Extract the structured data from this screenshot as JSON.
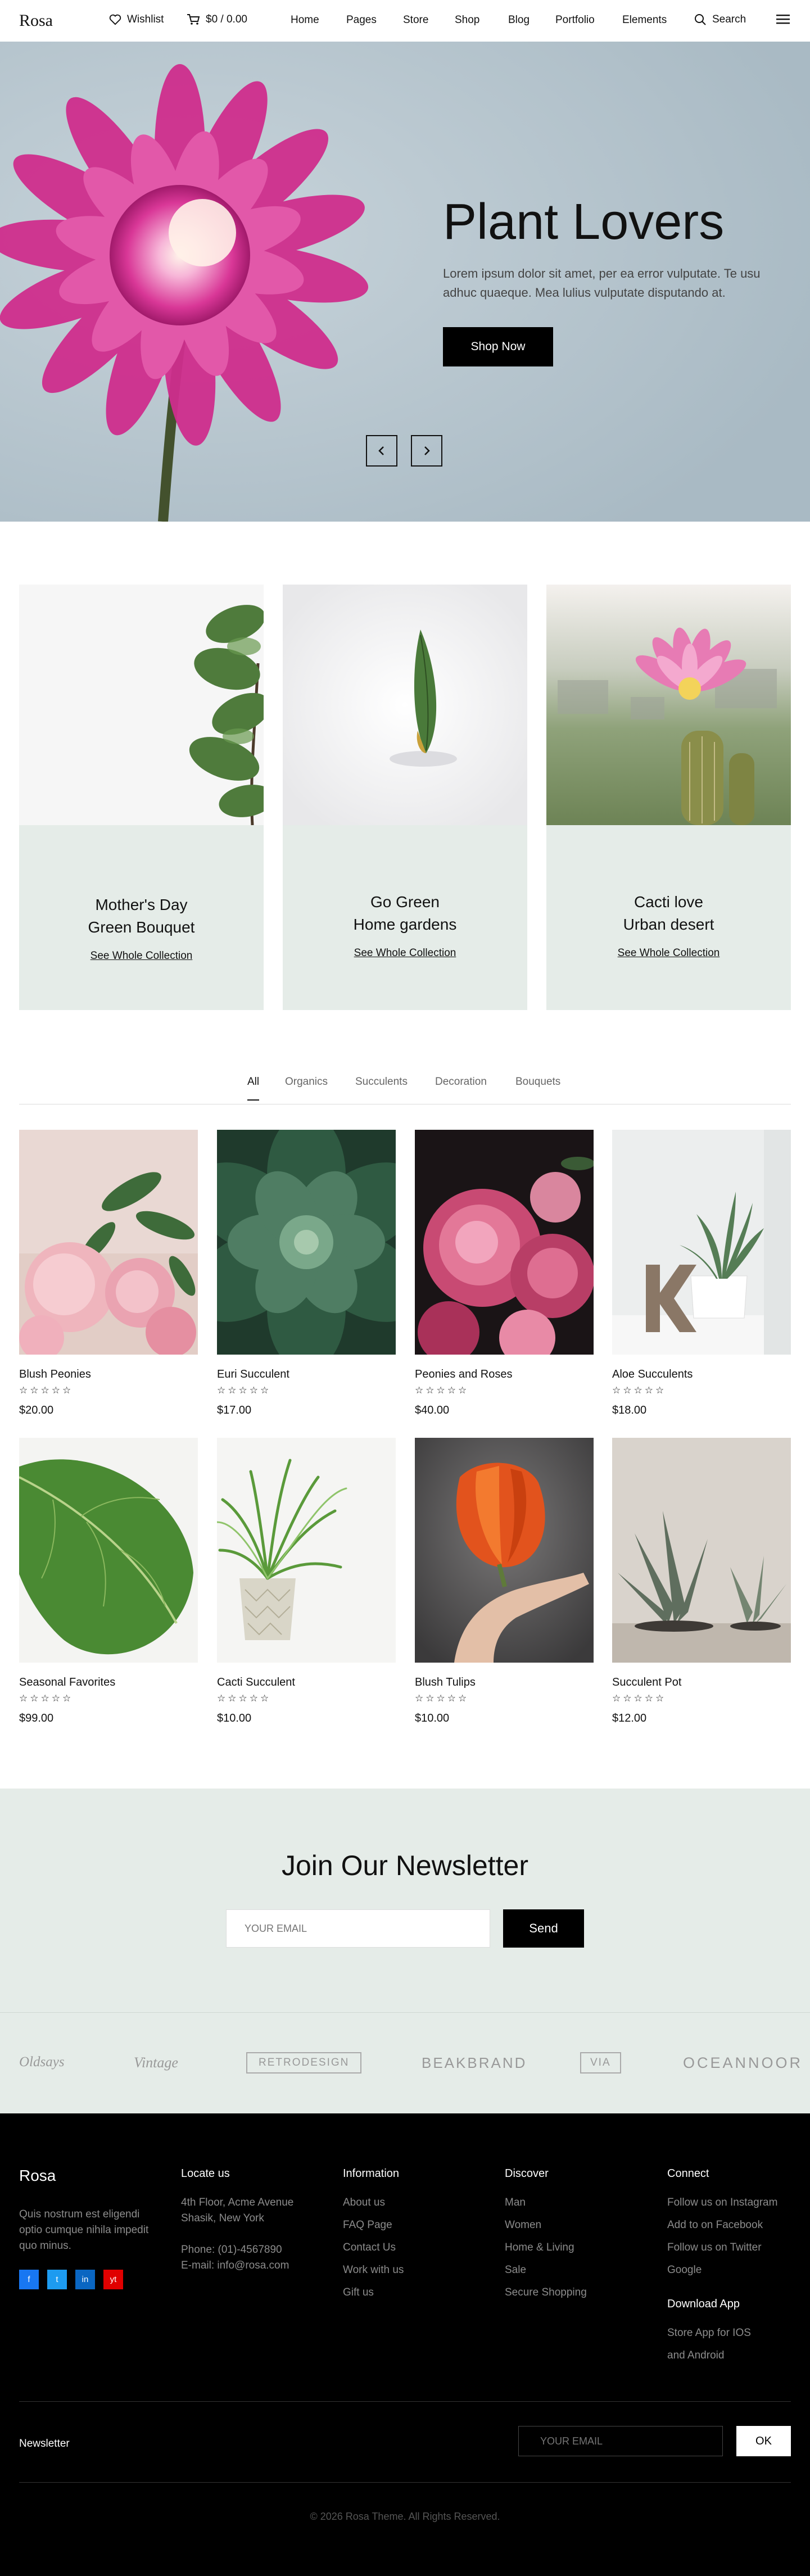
{
  "header": {
    "logo": "Rosa",
    "wishlist_label": "Wishlist",
    "cart_label": "$0 / 0.00",
    "nav": [
      "Home",
      "Pages",
      "Store",
      "Shop",
      "Blog",
      "Portfolio",
      "Elements"
    ],
    "search_label": "Search"
  },
  "hero": {
    "title": "Plant Lovers",
    "text": "Lorem ipsum dolor sit amet, per ea error vulputate. Te usu adhuc quaeque. Mea lulius vulputate disputando at.",
    "button": "Shop Now",
    "prev_icon": "chevron-left-icon",
    "next_icon": "chevron-right-icon"
  },
  "categories": [
    {
      "title_line1": "Mother's Day",
      "title_line2": "Green Bouquet",
      "link": "See Whole Collection"
    },
    {
      "title_line1": "Go Green",
      "title_line2": "Home gardens",
      "link": "See Whole Collection"
    },
    {
      "title_line1": "Cacti love",
      "title_line2": "Urban desert",
      "link": "See Whole Collection"
    }
  ],
  "tabs": [
    "All",
    "Organics",
    "Succulents",
    "Decoration",
    "Bouquets"
  ],
  "products": [
    {
      "name": "Blush Peonies",
      "stars": "☆☆☆☆☆",
      "price": "$20.00"
    },
    {
      "name": "Euri Succulent",
      "stars": "☆☆☆☆☆",
      "price": "$17.00"
    },
    {
      "name": "Peonies and Roses",
      "stars": "☆☆☆☆☆",
      "price": "$40.00"
    },
    {
      "name": "Aloe Succulents",
      "stars": "☆☆☆☆☆",
      "price": "$18.00"
    },
    {
      "name": "Seasonal Favorites",
      "stars": "☆☆☆☆☆",
      "price": "$99.00"
    },
    {
      "name": "Cacti Succulent",
      "stars": "☆☆☆☆☆",
      "price": "$10.00"
    },
    {
      "name": "Blush Tulips",
      "stars": "☆☆☆☆☆",
      "price": "$10.00"
    },
    {
      "name": "Succulent Pot",
      "stars": "☆☆☆☆☆",
      "price": "$12.00"
    }
  ],
  "newsletter": {
    "title": "Join Our Newsletter",
    "placeholder": "YOUR EMAIL",
    "button": "Send"
  },
  "brands": [
    "Oldsays",
    "Vintage",
    "RETRODESIGN",
    "BEAKBRAND",
    "VIA",
    "OCEANNOOR"
  ],
  "footer": {
    "logo": "Rosa",
    "about": "Quis nostrum est eligendi optio cumque nihila impedit quo minus.",
    "social": [
      "f",
      "t",
      "in",
      "yt"
    ],
    "locate": {
      "heading": "Locate us",
      "address1": "4th Floor, Acme Avenue",
      "address2": "Shasik, New York",
      "phone": "Phone: (01)-4567890",
      "email": "E-mail: info@rosa.com"
    },
    "information": {
      "heading": "Information",
      "items": [
        "About us",
        "FAQ Page",
        "Contact Us",
        "Work with us",
        "Gift us"
      ]
    },
    "discover": {
      "heading": "Discover",
      "items": [
        "Man",
        "Women",
        "Home & Living",
        "Sale",
        "Secure Shopping"
      ]
    },
    "connect": {
      "heading": "Connect",
      "items": [
        "Follow us on Instagram",
        "Add to on Facebook",
        "Follow us on Twitter",
        "Google"
      ]
    },
    "download": {
      "heading": "Download App",
      "items": [
        "Store App for IOS",
        "and Android"
      ]
    },
    "newsletter_label": "Newsletter",
    "newsletter_placeholder": "YOUR EMAIL",
    "newsletter_button": "OK",
    "copyright": "© 2026 Rosa Theme. All Rights Reserved."
  },
  "colors": {
    "accent_black": "#000000",
    "mint_background": "#e5ece8",
    "hero_background": "#b7c6cf",
    "facebook": "#1877f2",
    "twitter": "#1d9bf0",
    "linkedin": "#0a66c2",
    "youtube": "#e00000"
  }
}
